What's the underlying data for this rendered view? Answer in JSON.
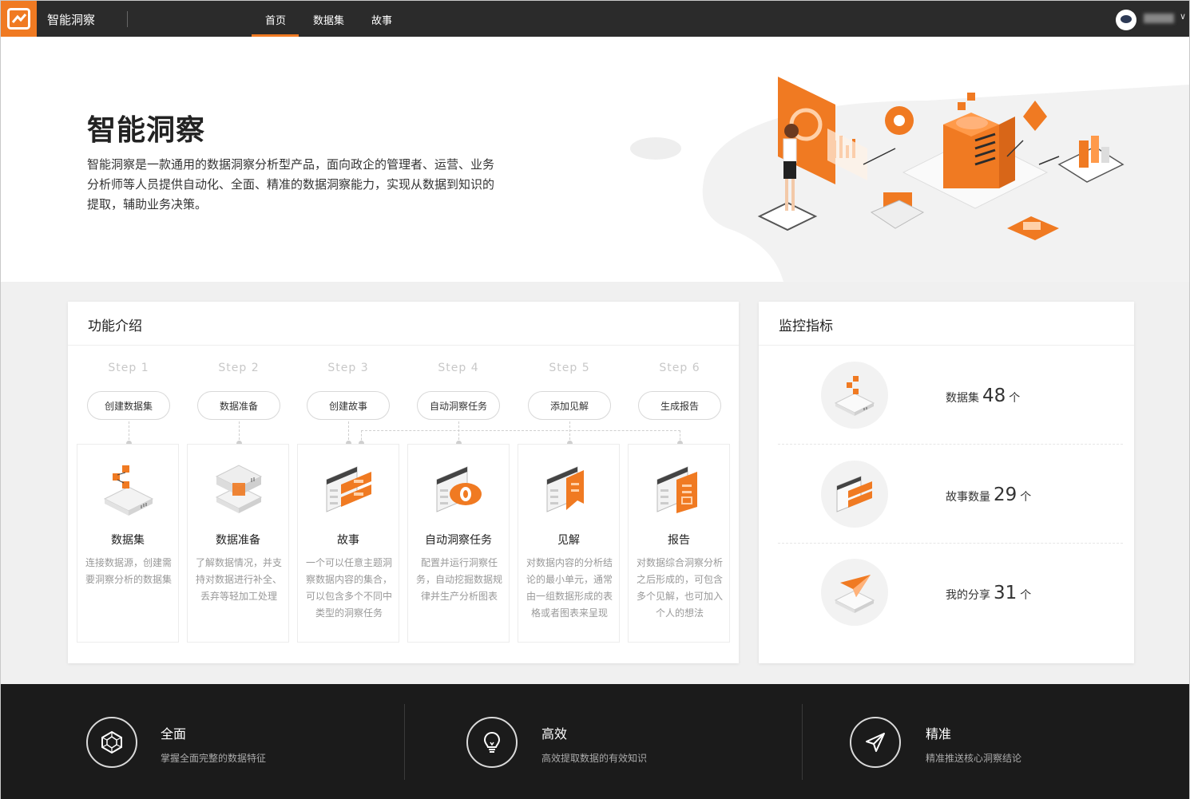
{
  "app": {
    "title": "智能洞察"
  },
  "nav": {
    "tabs": [
      "首页",
      "数据集",
      "故事"
    ],
    "active": 0
  },
  "hero": {
    "title": "智能洞察",
    "description_lines": [
      "智能洞察是一款通用的数据洞察分析型产品，面向政企的管理者、运营、业务",
      "分析师等人员提供自动化、全面、精准的数据洞察能力，实现从数据到知识的",
      "提取，辅助业务决策。"
    ]
  },
  "features": {
    "title": "功能介绍",
    "steps": [
      {
        "step": "Step 1",
        "action": "创建数据集",
        "name": "数据集",
        "desc": "连接数据源，创建需要洞察分析的数据集"
      },
      {
        "step": "Step 2",
        "action": "数据准备",
        "name": "数据准备",
        "desc": "了解数据情况，并支持对数据进行补全、丢弃等轻加工处理"
      },
      {
        "step": "Step 3",
        "action": "创建故事",
        "name": "故事",
        "desc": "一个可以任意主题洞察数据内容的集合，可以包含多个不同中类型的洞察任务"
      },
      {
        "step": "Step 4",
        "action": "自动洞察任务",
        "name": "自动洞察任务",
        "desc": "配置并运行洞察任务，自动挖掘数据规律并生产分析图表"
      },
      {
        "step": "Step 5",
        "action": "添加见解",
        "name": "见解",
        "desc": "对数据内容的分析结论的最小单元，通常由一组数据形成的表格或者图表来呈现"
      },
      {
        "step": "Step 6",
        "action": "生成报告",
        "name": "报告",
        "desc": "对数据综合洞察分析之后形成的，可包含多个见解，也可加入个人的想法"
      }
    ]
  },
  "metrics": {
    "title": "监控指标",
    "items": [
      {
        "label": "数据集",
        "value": "48",
        "unit": "个"
      },
      {
        "label": "故事数量",
        "value": "29",
        "unit": "个"
      },
      {
        "label": "我的分享",
        "value": "31",
        "unit": "个"
      }
    ]
  },
  "footer": {
    "items": [
      {
        "title": "全面",
        "subtitle": "掌握全面完整的数据特征"
      },
      {
        "title": "高效",
        "subtitle": "高效提取数据的有效知识"
      },
      {
        "title": "精准",
        "subtitle": "精准推送核心洞察结论"
      }
    ]
  },
  "colors": {
    "accent": "#f07a22",
    "topbar": "#2b2b2b",
    "footer": "#1b1b1b"
  }
}
